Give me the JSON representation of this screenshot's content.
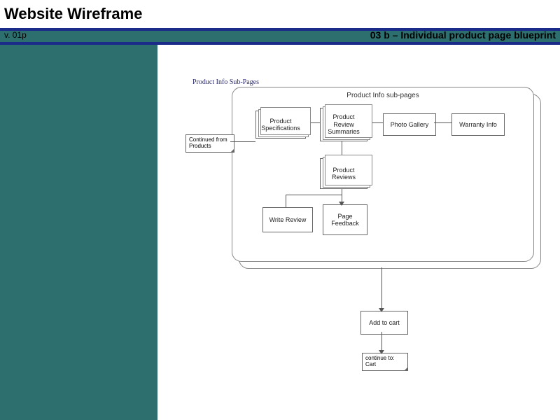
{
  "header": {
    "title": "Website Wireframe",
    "version": "v. 01p",
    "page_label": "03 b – Individual product page blueprint"
  },
  "diagram": {
    "section_label": "Product Info Sub-Pages",
    "panel_title": "Product Info sub-pages",
    "continued_from": "Continued from\nProducts",
    "boxes": {
      "specs": "Product\nSpecifications",
      "review_summaries": "Product\nReview\nSummaries",
      "photo_gallery": "Photo Gallery",
      "warranty": "Warranty Info",
      "product_reviews": "Product\nReviews",
      "write_review": "Write Review",
      "page_feedback": "Page\nFeedback",
      "add_to_cart": "Add to cart",
      "continue_to_cart": "continue to:\nCart"
    }
  }
}
